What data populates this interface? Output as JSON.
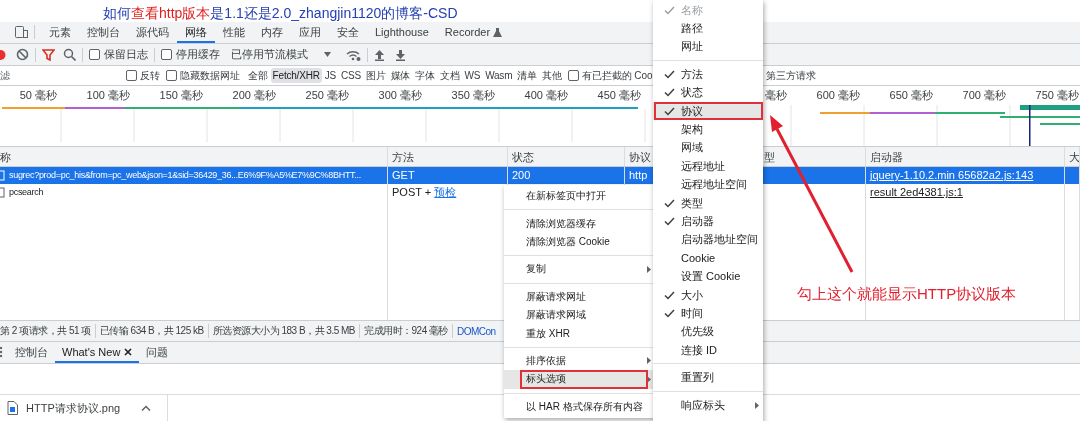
{
  "page_title": {
    "parts": [
      {
        "text": "如何",
        "highlighted": false
      },
      {
        "text": "查看http版本",
        "highlighted": true
      },
      {
        "text": "是1.1还是2.0_zhangjin1120的博客-CSD",
        "highlighted": false
      }
    ]
  },
  "panel_tabs": [
    {
      "label": "元素",
      "selected": false,
      "experimental": false
    },
    {
      "label": "控制台",
      "selected": false,
      "experimental": false
    },
    {
      "label": "源代码",
      "selected": false,
      "experimental": false
    },
    {
      "label": "网络",
      "selected": true,
      "experimental": false
    },
    {
      "label": "性能",
      "selected": false,
      "experimental": false
    },
    {
      "label": "内存",
      "selected": false,
      "experimental": false
    },
    {
      "label": "应用",
      "selected": false,
      "experimental": false
    },
    {
      "label": "安全",
      "selected": false,
      "experimental": false
    },
    {
      "label": "Lighthouse",
      "selected": false,
      "experimental": false
    },
    {
      "label": "Recorder",
      "selected": false,
      "experimental": true
    }
  ],
  "toolbar": {
    "recording": true,
    "preserve_log": {
      "label": "保留日志",
      "checked": false
    },
    "disable_cache": {
      "label": "停用缓存",
      "checked": false
    },
    "throttling": "已停用节流模式"
  },
  "filter": {
    "placeholder": "滤",
    "invert": {
      "label": "反转",
      "checked": false
    },
    "hide_data_urls": {
      "label": "隐藏数据网址",
      "checked": false
    },
    "types": [
      {
        "label": "全部",
        "selected": false
      },
      {
        "label": "Fetch/XHR",
        "selected": true
      },
      {
        "label": "JS",
        "selected": false
      },
      {
        "label": "CSS",
        "selected": false
      },
      {
        "label": "图片",
        "selected": false
      },
      {
        "label": "媒体",
        "selected": false
      },
      {
        "label": "字体",
        "selected": false
      },
      {
        "label": "文档",
        "selected": false
      },
      {
        "label": "WS",
        "selected": false
      },
      {
        "label": "Wasm",
        "selected": false
      },
      {
        "label": "清单",
        "selected": false
      },
      {
        "label": "其他",
        "selected": false
      }
    ],
    "blocked_cookies": {
      "label": "有已拦截的 Coo",
      "checked": false
    },
    "third_party": "第三方请求"
  },
  "timeline": {
    "ticks_before_menu": [
      "50 毫秒",
      "100 毫秒",
      "150 毫秒",
      "200 毫秒",
      "250 毫秒",
      "300 毫秒",
      "350 毫秒",
      "400 毫秒",
      "450 毫秒"
    ],
    "ticks_after_menu": [
      "毫秒",
      "600 毫秒",
      "650 毫秒",
      "700 毫秒",
      "750 毫秒"
    ]
  },
  "table": {
    "columns": [
      "称",
      "方法",
      "状态",
      "协议",
      "型",
      "启动器",
      "大"
    ],
    "rows": [
      {
        "name": "sugrec?prod=pc_his&from=pc_web&json=1&sid=36429_36...E6%9F%A5%E7%9C%8BHTT...",
        "method": "GET",
        "status": "200",
        "protocol": "http",
        "initiator": "jquery-1.10.2.min 65682a2.js:143",
        "selected": true
      },
      {
        "name": "pcsearch",
        "method": "POST +",
        "preflight": "预检",
        "initiator": "result 2ed4381.js:1",
        "selected": false
      }
    ]
  },
  "status_bar": [
    {
      "text": "第 2 项请求，共 51 项",
      "kind": "stat"
    },
    {
      "text": "已传输 634 B，共 125 kB",
      "kind": "stat"
    },
    {
      "text": "所选资源大小为 183 B，共 3.5 MB",
      "kind": "stat"
    },
    {
      "text": "完成用时：924 毫秒",
      "kind": "stat"
    },
    {
      "text": "DOMCon",
      "kind": "link"
    }
  ],
  "drawer_tabs": [
    {
      "label": "控制台",
      "selected": false,
      "closable": false
    },
    {
      "label": "What's New",
      "selected": true,
      "closable": true
    },
    {
      "label": "问题",
      "selected": false,
      "closable": false
    }
  ],
  "download": {
    "filename": "HTTP请求协议.png"
  },
  "context_menu": [
    {
      "kind": "item",
      "label": "在新标签页中打开",
      "highlighted": false
    },
    {
      "kind": "separator"
    },
    {
      "kind": "item",
      "label": "清除浏览器缓存",
      "highlighted": false
    },
    {
      "kind": "item",
      "label": "清除浏览器 Cookie",
      "highlighted": false
    },
    {
      "kind": "separator"
    },
    {
      "kind": "submenu",
      "label": "复制",
      "highlighted": false
    },
    {
      "kind": "separator"
    },
    {
      "kind": "item",
      "label": "屏蔽请求网址",
      "highlighted": false
    },
    {
      "kind": "item",
      "label": "屏蔽请求网域",
      "highlighted": false
    },
    {
      "kind": "item",
      "label": "重放 XHR",
      "highlighted": false
    },
    {
      "kind": "separator"
    },
    {
      "kind": "submenu",
      "label": "排序依据",
      "highlighted": false
    },
    {
      "kind": "submenu",
      "label": "标头选项",
      "highlighted": true
    },
    {
      "kind": "separator"
    },
    {
      "kind": "item",
      "label": "以 HAR 格式保存所有内容",
      "highlighted": false
    }
  ],
  "columns_menu": [
    {
      "kind": "check",
      "label": "名称",
      "checked": true,
      "disabled": true,
      "highlighted": false
    },
    {
      "kind": "check",
      "label": "路径",
      "checked": false,
      "disabled": false,
      "highlighted": false
    },
    {
      "kind": "check",
      "label": "网址",
      "checked": false,
      "disabled": false,
      "highlighted": false
    },
    {
      "kind": "separator"
    },
    {
      "kind": "check",
      "label": "方法",
      "checked": true,
      "disabled": false,
      "highlighted": false
    },
    {
      "kind": "check",
      "label": "状态",
      "checked": true,
      "disabled": false,
      "highlighted": false
    },
    {
      "kind": "check",
      "label": "协议",
      "checked": true,
      "disabled": false,
      "highlighted": true
    },
    {
      "kind": "check",
      "label": "架构",
      "checked": false,
      "disabled": false,
      "highlighted": false
    },
    {
      "kind": "check",
      "label": "网域",
      "checked": false,
      "disabled": false,
      "highlighted": false
    },
    {
      "kind": "check",
      "label": "远程地址",
      "checked": false,
      "disabled": false,
      "highlighted": false
    },
    {
      "kind": "check",
      "label": "远程地址空间",
      "checked": false,
      "disabled": false,
      "highlighted": false
    },
    {
      "kind": "check",
      "label": "类型",
      "checked": true,
      "disabled": false,
      "highlighted": false
    },
    {
      "kind": "check",
      "label": "启动器",
      "checked": true,
      "disabled": false,
      "highlighted": false
    },
    {
      "kind": "check",
      "label": "启动器地址空间",
      "checked": false,
      "disabled": false,
      "highlighted": false
    },
    {
      "kind": "check",
      "label": "Cookie",
      "checked": false,
      "disabled": false,
      "highlighted": false
    },
    {
      "kind": "check",
      "label": "设置 Cookie",
      "checked": false,
      "disabled": false,
      "highlighted": false
    },
    {
      "kind": "check",
      "label": "大小",
      "checked": true,
      "disabled": false,
      "highlighted": false
    },
    {
      "kind": "check",
      "label": "时间",
      "checked": true,
      "disabled": false,
      "highlighted": false
    },
    {
      "kind": "check",
      "label": "优先级",
      "checked": false,
      "disabled": false,
      "highlighted": false
    },
    {
      "kind": "check",
      "label": "连接 ID",
      "checked": false,
      "disabled": false,
      "highlighted": false
    },
    {
      "kind": "separator"
    },
    {
      "kind": "item",
      "label": "重置列",
      "highlighted": false
    },
    {
      "kind": "separator"
    },
    {
      "kind": "submenu",
      "label": "响应标头",
      "highlighted": false
    }
  ],
  "annotation": {
    "text": "勾上这个就能显示HTTP协议版本"
  }
}
